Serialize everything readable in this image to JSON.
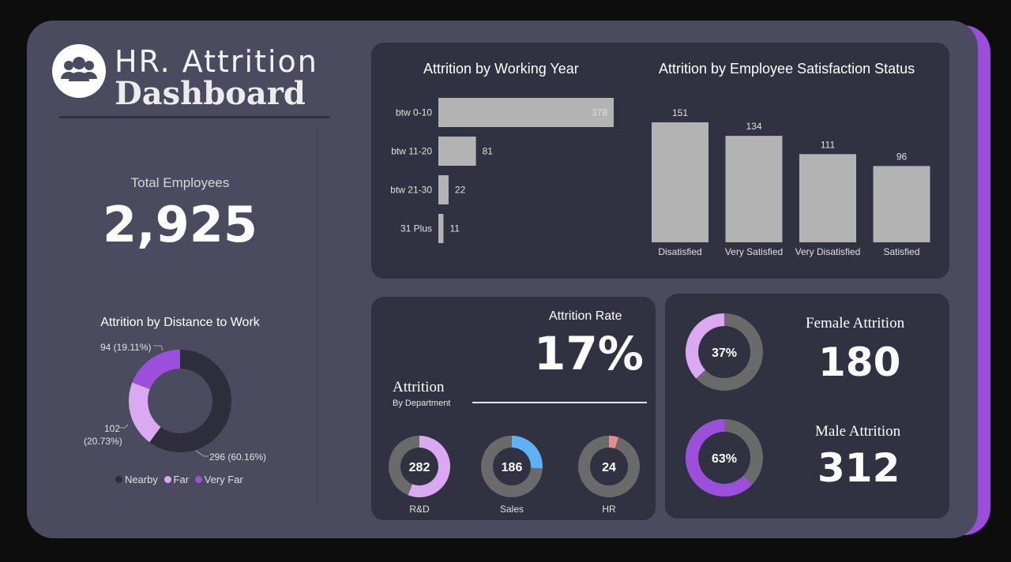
{
  "logo": {
    "line1": "HR. Attrition",
    "line2": "Dashboard",
    "icon": "people-group-icon"
  },
  "total": {
    "label": "Total Employees",
    "value": "2,925"
  },
  "colors": {
    "nearby": "#2e2d3c",
    "far": "#dba8f2",
    "very_far": "#9b4fdb",
    "bar": "#b3b3b3",
    "sales": "#5eb2f2",
    "hr": "#e88a92",
    "gray_ring": "#6a6a6a",
    "accent": "#9c4ddb"
  },
  "distance": {
    "title": "Attrition by Distance to Work",
    "labels": {
      "very_far": "94 (19.11%)",
      "far_line1": "102",
      "far_line2": "(20.73%)",
      "nearby": "296 (60.16%)"
    },
    "legend": [
      "Nearby",
      "Far",
      "Very Far"
    ]
  },
  "working_year": {
    "title": "Attrition by Working Year"
  },
  "satisfaction": {
    "title": "Attrition by Employee Satisfaction Status"
  },
  "attrition_rate": {
    "label": "Attrition Rate",
    "value": "17%"
  },
  "department": {
    "title": "Attrition",
    "subtitle": "By Department"
  },
  "female": {
    "label": "Female Attrition",
    "value": "180",
    "pct": "37%"
  },
  "male": {
    "label": "Male Attrition",
    "value": "312",
    "pct": "63%"
  },
  "chart_data": [
    {
      "type": "bar",
      "orientation": "horizontal",
      "title": "Attrition by Working Year",
      "categories": [
        "btw 0-10",
        "btw 11-20",
        "btw 21-30",
        "31 Plus"
      ],
      "values": [
        378,
        81,
        22,
        11
      ]
    },
    {
      "type": "bar",
      "title": "Attrition by Employee Satisfaction Status",
      "categories": [
        "Disatisfied",
        "Very Satisfied",
        "Very Disatisfied",
        "Satisfied"
      ],
      "values": [
        151,
        134,
        111,
        96
      ]
    },
    {
      "type": "pie",
      "title": "Attrition by Distance to Work",
      "categories": [
        "Nearby",
        "Far",
        "Very Far"
      ],
      "values": [
        296,
        102,
        94
      ],
      "percent": [
        60.16,
        20.73,
        19.11
      ],
      "legend": "bottom"
    },
    {
      "type": "pie",
      "title": "Attrition By Department",
      "categories": [
        "R&D",
        "Sales",
        "HR"
      ],
      "values": [
        282,
        186,
        24
      ],
      "share_of_department": [
        0.56,
        0.26,
        0.05
      ]
    },
    {
      "type": "pie",
      "title": "Female Attrition",
      "values": [
        0.37,
        0.63
      ]
    },
    {
      "type": "pie",
      "title": "Male Attrition",
      "values": [
        0.63,
        0.37
      ]
    }
  ]
}
